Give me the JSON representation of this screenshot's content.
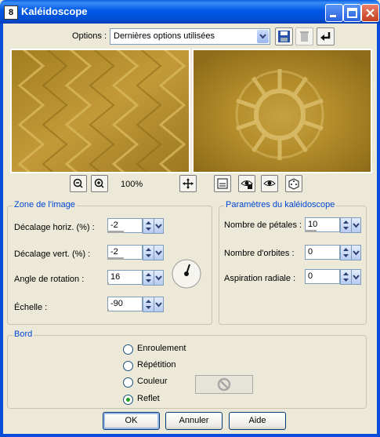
{
  "window": {
    "title": "Kaléidoscope",
    "icon_label": "8"
  },
  "options": {
    "label": "Options :",
    "value": "Dernières options utilisées"
  },
  "zoom": {
    "level": "100%"
  },
  "zone": {
    "title": "Zone de l'image",
    "fields": [
      {
        "label": "Décalage horiz. (%) :",
        "value": "-2",
        "bar_fraction": 0.49
      },
      {
        "label": "Décalage vert. (%) :",
        "value": "-2",
        "bar_fraction": 0.49
      },
      {
        "label": "Angle de rotation :",
        "value": "16",
        "bar_fraction": 0.04
      },
      {
        "label": "Échelle :",
        "value": "-90",
        "bar_fraction": 0.05
      }
    ]
  },
  "params": {
    "title": "Paramètres du kaléidoscope",
    "fields": [
      {
        "label": "Nombre de pétales :",
        "value": "10",
        "bar_fraction": 0.35
      },
      {
        "label": "Nombre d'orbites :",
        "value": "0",
        "bar_fraction": 0.0
      },
      {
        "label": "Aspiration radiale :",
        "value": "0",
        "bar_fraction": 0.0
      }
    ]
  },
  "bord": {
    "title": "Bord",
    "options": [
      "Enroulement",
      "Répétition",
      "Couleur",
      "Reflet"
    ],
    "selected": "Reflet"
  },
  "buttons": {
    "ok": "OK",
    "cancel": "Annuler",
    "help": "Aide"
  },
  "colors": {
    "accent": "#0046d5",
    "titlebar": "#0058e6",
    "preview_gold": "#b48c2a"
  }
}
